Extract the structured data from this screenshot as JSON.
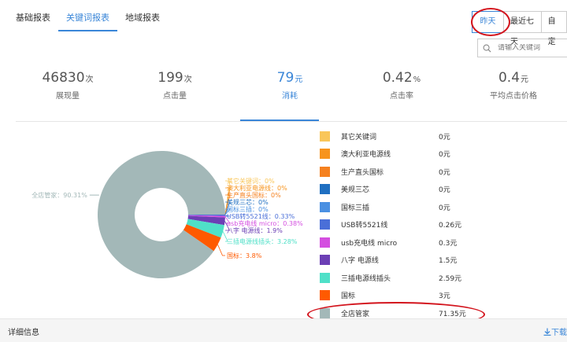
{
  "tabs": [
    {
      "label": "基础报表",
      "active": false
    },
    {
      "label": "关键词报表",
      "active": true
    },
    {
      "label": "地域报表",
      "active": false
    }
  ],
  "range": {
    "options": [
      "昨天",
      "最近七天",
      "自定"
    ],
    "selected": "昨天"
  },
  "search": {
    "placeholder": "请输入关键词"
  },
  "metrics": [
    {
      "value": "46830",
      "unit": "次",
      "label": "展现量",
      "active": false
    },
    {
      "value": "199",
      "unit": "次",
      "label": "点击量",
      "active": false
    },
    {
      "value": "79",
      "unit": "元",
      "label": "消耗",
      "active": true
    },
    {
      "value": "0.42",
      "unit": "%",
      "label": "点击率",
      "active": false
    },
    {
      "value": "0.4",
      "unit": "元",
      "label": "平均点击价格",
      "active": false
    }
  ],
  "chart_data": {
    "type": "pie",
    "donut": true,
    "slices": [
      {
        "name": "其它关键词",
        "value": 0,
        "label": "其它关键词：0%",
        "color": "#f9c65a"
      },
      {
        "name": "澳大利亚电源线",
        "value": 0,
        "label": "澳大利亚电源线：0%",
        "color": "#f7941d"
      },
      {
        "name": "生产直头国标",
        "value": 0,
        "label": "生产直头国标：0%",
        "color": "#f5811f"
      },
      {
        "name": "美规三芯",
        "value": 0,
        "label": "美规三芯：0%",
        "color": "#1f6fc1"
      },
      {
        "name": "国标三插",
        "value": 0,
        "label": "国标三插：0%",
        "color": "#4a90e2"
      },
      {
        "name": "USB转5521线",
        "value": 0.33,
        "label": "USB转5521线：0.33%",
        "color": "#4a6fd8"
      },
      {
        "name": "usb充电线 micro",
        "value": 0.38,
        "label": "usb充电线 micro：0.38%",
        "color": "#d44ee0"
      },
      {
        "name": "八字 电源线",
        "value": 1.9,
        "label": "八字 电源线：1.9%",
        "color": "#6c3fb5"
      },
      {
        "name": "三插电源线插头",
        "value": 3.28,
        "label": "三插电源线插头：3.28%",
        "color": "#4fe0c8"
      },
      {
        "name": "国标",
        "value": 3.8,
        "label": "国标：3.8%",
        "color": "#ff5a00"
      },
      {
        "name": "全店管家",
        "value": 90.31,
        "label": "全店管家：90.31%",
        "color": "#a3b8b8"
      }
    ]
  },
  "legend": [
    {
      "name": "其它关键词",
      "value": "0元",
      "color": "#f9c65a"
    },
    {
      "name": "澳大利亚电源线",
      "value": "0元",
      "color": "#f7941d"
    },
    {
      "name": "生产直头国标",
      "value": "0元",
      "color": "#f5811f"
    },
    {
      "name": "美规三芯",
      "value": "0元",
      "color": "#1f6fc1"
    },
    {
      "name": "国标三插",
      "value": "0元",
      "color": "#4a90e2"
    },
    {
      "name": "USB转5521线",
      "value": "0.26元",
      "color": "#4a6fd8"
    },
    {
      "name": "usb充电线 micro",
      "value": "0.3元",
      "color": "#d44ee0"
    },
    {
      "name": "八字 电源线",
      "value": "1.5元",
      "color": "#6c3fb5"
    },
    {
      "name": "三插电源线插头",
      "value": "2.59元",
      "color": "#4fe0c8"
    },
    {
      "name": "国标",
      "value": "3元",
      "color": "#ff5a00"
    },
    {
      "name": "全店管家",
      "value": "71.35元",
      "color": "#a3b8b8"
    }
  ],
  "footer": {
    "title": "详细信息",
    "download": "下载"
  },
  "annotation_color": "#d3141d"
}
